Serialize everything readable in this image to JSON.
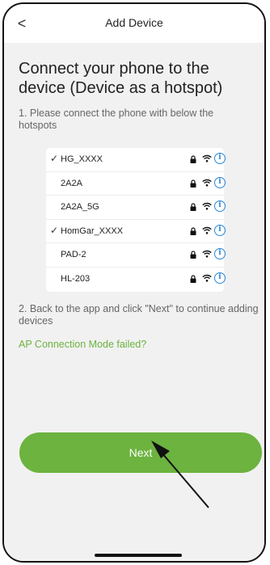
{
  "header": {
    "back_icon": "chevron-left-icon",
    "back_glyph": "<",
    "title": "Add Device"
  },
  "main": {
    "heading": "Connect your phone to the device (Device as a hotspot)",
    "step1": "1. Please connect the phone with below the hotspots",
    "step2": "2. Back to the app and click \"Next\" to continue adding devices",
    "ap_link": "AP Connection Mode failed?",
    "next_label": "Next"
  },
  "wifi_list": [
    {
      "name": "HG_XXXX",
      "check": "✓"
    },
    {
      "name": "2A2A",
      "check": ""
    },
    {
      "name": "2A2A_5G",
      "check": ""
    },
    {
      "name": "HomGar_XXXX",
      "check": "✓"
    },
    {
      "name": "PAD-2",
      "check": ""
    },
    {
      "name": "HL-203",
      "check": ""
    }
  ],
  "info_glyph": "i",
  "colors": {
    "accent_green": "#6cb33f",
    "info_blue": "#2a86d8",
    "background": "#f1f1f1"
  }
}
